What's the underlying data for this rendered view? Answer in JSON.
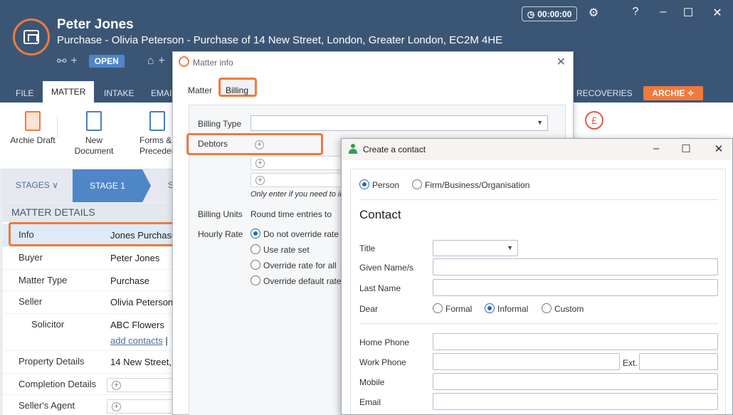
{
  "header": {
    "client_name": "Peter Jones",
    "matter_description": "Purchase - Olivia Peterson - Purchase of 14 New Street, London, Greater London, EC2M 4HE",
    "status": "OPEN",
    "timer": "00:00:00"
  },
  "tabs": [
    "FILE",
    "MATTER",
    "INTAKE",
    "EMAIL",
    "RECOVERIES"
  ],
  "archie_button": "ARCHIE",
  "ribbon": {
    "archie_draft": "Archie Draft",
    "new_document": "New Document",
    "forms": "Forms & Precedents"
  },
  "stages": {
    "label": "STAGES",
    "current": "STAGE 1",
    "next": "S"
  },
  "matter_details": {
    "title": "MATTER DETAILS",
    "rows": [
      {
        "key": "Info",
        "value": "Jones Purchase"
      },
      {
        "key": "Buyer",
        "value": "Peter Jones"
      },
      {
        "key": "Matter Type",
        "value": "Purchase"
      },
      {
        "key": "Seller",
        "value": "Olivia Peterson"
      },
      {
        "key": "Solicitor",
        "value": "ABC Flowers",
        "link": "add contacts",
        "sep": "|"
      },
      {
        "key": "Property Details",
        "value": "14 New Street,"
      },
      {
        "key": "Completion Details",
        "value": ""
      },
      {
        "key": "Seller's Agent",
        "value": ""
      }
    ]
  },
  "matter_info": {
    "title": "Matter info",
    "tabs": [
      "Matter",
      "Billing"
    ],
    "billing_type_label": "Billing Type",
    "billing_type_value": "",
    "debtors_label": "Debtors",
    "debtors_note": "Only enter if you need to in",
    "billing_units_label": "Billing Units",
    "billing_units_value": "Round time entries to",
    "hourly_rate_label": "Hourly Rate",
    "rate_options": [
      "Do not override rate",
      "Use rate set",
      "Override rate for all",
      "Override default rate"
    ],
    "rate_selected": 0
  },
  "create_contact": {
    "title": "Create a contact",
    "type_options": [
      "Person",
      "Firm/Business/Organisation"
    ],
    "type_selected": 0,
    "section_title": "Contact",
    "fields": {
      "title": "Title",
      "given_name": "Given Name/s",
      "last_name": "Last Name",
      "dear": "Dear",
      "home_phone": "Home Phone",
      "work_phone": "Work Phone",
      "ext": "Ext.",
      "mobile": "Mobile",
      "email": "Email"
    },
    "dear_options": [
      "Formal",
      "Informal",
      "Custom"
    ],
    "dear_selected": 1
  },
  "colors": {
    "header": "#3b5675",
    "accent": "#f07a3c",
    "active_stage": "#4e86c8"
  }
}
